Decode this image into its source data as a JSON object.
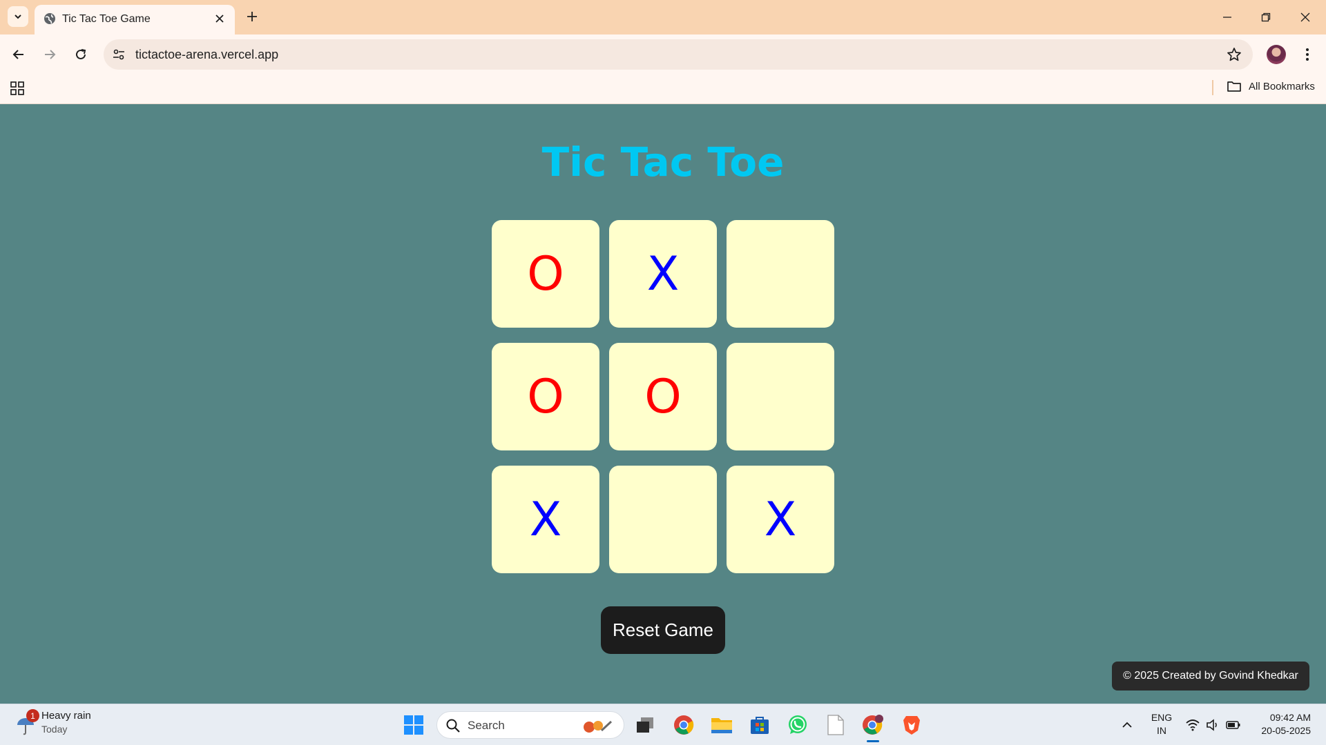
{
  "browser": {
    "tab_title": "Tic Tac Toe Game",
    "url": "tictactoe-arena.vercel.app",
    "bookmarks_label": "All Bookmarks"
  },
  "game": {
    "title": "Tic Tac Toe",
    "board": [
      [
        {
          "mark": "O",
          "color": "#ff0000"
        },
        {
          "mark": "X",
          "color": "#0000ff"
        },
        {
          "mark": "",
          "color": ""
        }
      ],
      [
        {
          "mark": "O",
          "color": "#ff0000"
        },
        {
          "mark": "O",
          "color": "#ff0000"
        },
        {
          "mark": "",
          "color": ""
        }
      ],
      [
        {
          "mark": "X",
          "color": "#0000ff"
        },
        {
          "mark": "",
          "color": ""
        },
        {
          "mark": "X",
          "color": "#0000ff"
        }
      ]
    ],
    "reset_label": "Reset Game",
    "credit": "© 2025 Created by Govind Khedkar"
  },
  "colors": {
    "page_background": "#558585",
    "title": "#00c8f2",
    "cell_background": "#ffffcc",
    "o_mark": "#ff0000",
    "x_mark": "#0000ff"
  },
  "taskbar": {
    "weather_title": "Heavy rain",
    "weather_sub": "Today",
    "weather_badge": "1",
    "search_placeholder": "Search",
    "lang_top": "ENG",
    "lang_bottom": "IN",
    "time": "09:42 AM",
    "date": "20-05-2025"
  }
}
